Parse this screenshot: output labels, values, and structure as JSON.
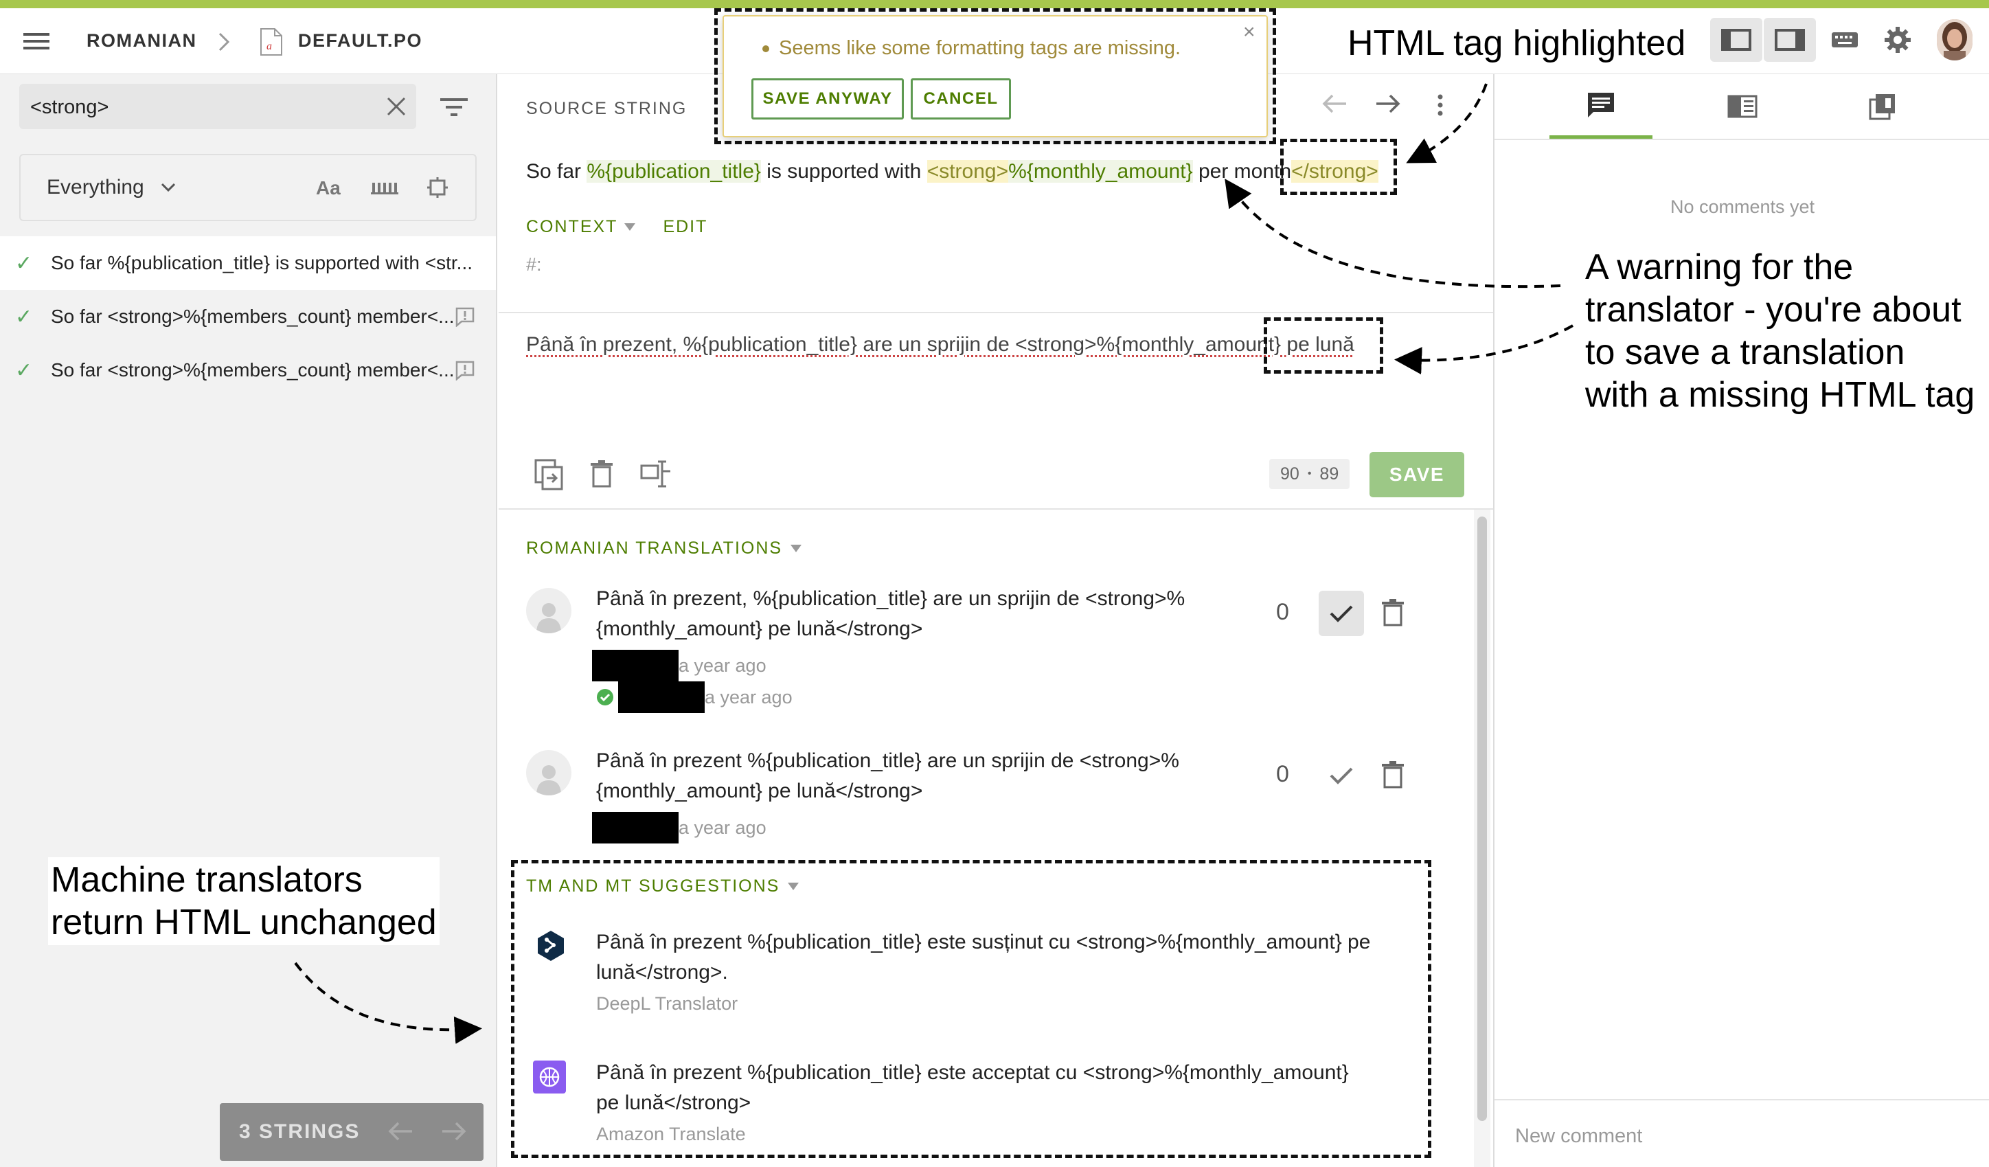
{
  "header": {
    "locale": "ROMANIAN",
    "file": "DEFAULT.PO"
  },
  "warning": {
    "message": "Seems like some formatting tags are missing.",
    "save_anyway": "SAVE ANYWAY",
    "cancel": "CANCEL",
    "close": "×"
  },
  "search": {
    "value": "<strong>",
    "filter": "Everything",
    "match_case": "Aa"
  },
  "strings": [
    {
      "text": "So far %{publication_title} is supported with <str..."
    },
    {
      "text": "So far <strong>%{members_count} member<..."
    },
    {
      "text": "So far <strong>%{members_count} member<..."
    }
  ],
  "footer": {
    "count": "3 STRINGS"
  },
  "source": {
    "label": "SOURCE STRING",
    "p1": "So far ",
    "p2": "%{publication_title}",
    "p3": " is supported with ",
    "p4": "<strong>",
    "p5": "%{monthly_amount}",
    "p6": " per month",
    "p7": "</strong>"
  },
  "context": {
    "label": "CONTEXT",
    "edit": "EDIT",
    "comment": "#:"
  },
  "editor": {
    "value": "Până în prezent, %{publication_title} are un sprijin de <strong>%{monthly_amount} pe lună",
    "counter_a": "90",
    "counter_b": "89",
    "save": "SAVE"
  },
  "translations": {
    "title": "ROMANIAN TRANSLATIONS",
    "items": [
      {
        "line1": "Până în prezent, %{publication_title} are un sprijin de <strong>%",
        "line2": "{monthly_amount} pe lună</strong>",
        "votes": "0",
        "time1": "a year ago",
        "time2": "a year ago"
      },
      {
        "line1": "Până în prezent %{publication_title} are un sprijin de <strong>%",
        "line2": "{monthly_amount} pe lună</strong>",
        "votes": "0",
        "time1": "a year ago"
      }
    ]
  },
  "suggestions": {
    "title": "TM AND MT SUGGESTIONS",
    "items": [
      {
        "line1": "Până în prezent %{publication_title} este susținut cu <strong>%{monthly_amount} pe",
        "line2": "lună</strong>.",
        "source": "DeepL Translator"
      },
      {
        "line1": "Până în prezent %{publication_title} este acceptat cu <strong>%{monthly_amount}",
        "line2": "pe lună</strong>",
        "source": "Amazon Translate"
      }
    ]
  },
  "comments": {
    "empty": "No comments yet",
    "placeholder": "New comment"
  },
  "annotations": {
    "html_tag": "HTML tag highlighted",
    "warning_l1": "A warning for the",
    "warning_l2": "translator - you're about",
    "warning_l3": "to save a translation",
    "warning_l4": "with a missing HTML tag",
    "mt_l1": "Machine translators",
    "mt_l2": "return HTML unchanged"
  },
  "colors": {
    "accent": "#7bb349",
    "highlight": "#4d7d00",
    "warning": "#a08a3a"
  }
}
